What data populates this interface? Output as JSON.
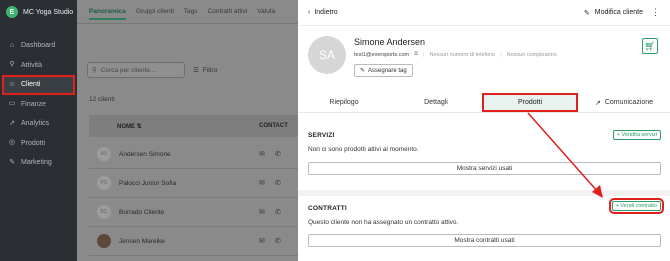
{
  "brand": {
    "logo_letter": "E",
    "name": "MC Yoga Studio"
  },
  "sidebar": {
    "items": [
      {
        "icon": "home-icon",
        "glyph": "⌂",
        "label": "Dashboard"
      },
      {
        "icon": "activity-icon",
        "glyph": "⚲",
        "label": "Attività"
      },
      {
        "icon": "user-icon",
        "glyph": "☺",
        "label": "Clienti"
      },
      {
        "icon": "finance-icon",
        "glyph": "▭",
        "label": "Finanze"
      },
      {
        "icon": "analytics-icon",
        "glyph": "↗",
        "label": "Analytics"
      },
      {
        "icon": "products-icon",
        "glyph": "◎",
        "label": "Prodotti"
      },
      {
        "icon": "marketing-icon",
        "glyph": "✎",
        "label": "Marketing"
      }
    ]
  },
  "main": {
    "tabs": [
      "Panoramica",
      "Gruppi clienti",
      "Tags",
      "Contratti attivi",
      "Valuta"
    ],
    "search_placeholder": "Cerca per cliente...",
    "filter_label": "Filtro",
    "count": "12 clienti",
    "col_name": "NOME",
    "col_contact": "CONTACT",
    "rows": [
      {
        "initials": "AS",
        "name": "Andersen Simone"
      },
      {
        "initials": "PS",
        "name": "Palocci Junior Sofia"
      },
      {
        "initials": "BC",
        "name": "Borrado Cliente"
      },
      {
        "initials": "",
        "name": "Jensen Mareike"
      }
    ]
  },
  "panel": {
    "back_label": "Indietro",
    "modify_label": "Modifica cliente",
    "avatar_initials": "SA",
    "name": "Simone Andersen",
    "email": "test1@eversports.com",
    "phone": "Nessun numero di telefono",
    "birthday": "Nessun compleanno",
    "tag_label": "Assegnare tag",
    "tabs": [
      "Riepilogo",
      "Dettagli",
      "Prodotti",
      "Comunicazione"
    ],
    "servizi": {
      "title": "SERVIZI",
      "add_label": "+ Vendita servizi",
      "empty_text": "Non ci sono prodotti attivi al momento.",
      "show_label": "Mostra servizi usati"
    },
    "contratti": {
      "title": "CONTRATTI",
      "add_label": "+ Vendi contratto",
      "empty_text": "Questo cliente non ha assegnato un contratto attivo.",
      "show_label": "Mostra contratti usati"
    }
  },
  "colors": {
    "highlight": "#e0201a",
    "accent": "#2e9b6a"
  }
}
